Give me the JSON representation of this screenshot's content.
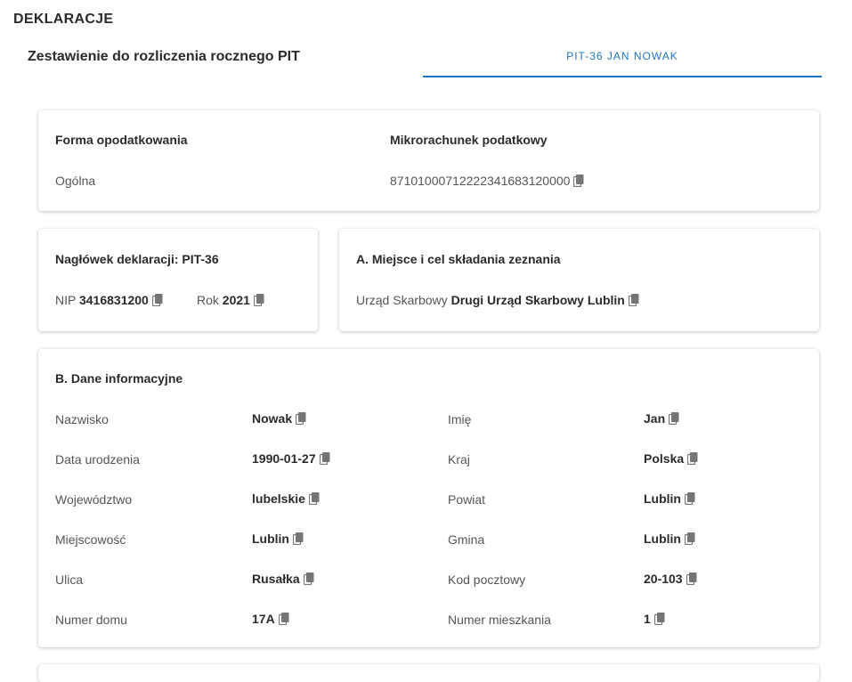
{
  "header": {
    "app_title": "DEKLARACJE",
    "page_subtitle": "Zestawienie do rozliczenia rocznego PIT",
    "tab_label": "PIT-36 JAN NOWAK"
  },
  "colors": {
    "accent": "#1f74c0",
    "icon": "#757575"
  },
  "icons": {
    "copy": "copy-icon"
  },
  "card_forma": {
    "forma_label": "Forma opodatkowania",
    "forma_value": "Ogólna",
    "mikro_label": "Mikrorachunek podatkowy",
    "mikro_value": "87101000712222341683120000"
  },
  "card_naglowek": {
    "title": "Nagłówek deklaracji: PIT-36",
    "nip_label": "NIP",
    "nip_value": "3416831200",
    "rok_label": "Rok",
    "rok_value": "2021"
  },
  "card_miejsce": {
    "title": "A. Miejsce i cel składania zeznania",
    "urzad_label": "Urząd Skarbowy",
    "urzad_value": "Drugi Urząd Skarbowy Lublin"
  },
  "card_dane": {
    "title": "B. Dane informacyjne",
    "left": [
      {
        "label": "Nazwisko",
        "value": "Nowak"
      },
      {
        "label": "Data urodzenia",
        "value": "1990-01-27"
      },
      {
        "label": "Województwo",
        "value": "lubelskie"
      },
      {
        "label": "Miejscowość",
        "value": "Lublin"
      },
      {
        "label": "Ulica",
        "value": "Rusałka"
      },
      {
        "label": "Numer domu",
        "value": "17A"
      }
    ],
    "right": [
      {
        "label": "Imię",
        "value": "Jan"
      },
      {
        "label": "Kraj",
        "value": "Polska"
      },
      {
        "label": "Powiat",
        "value": "Lublin"
      },
      {
        "label": "Gmina",
        "value": "Lublin"
      },
      {
        "label": "Kod pocztowy",
        "value": "20-103"
      },
      {
        "label": "Numer mieszkania",
        "value": "1"
      }
    ]
  }
}
